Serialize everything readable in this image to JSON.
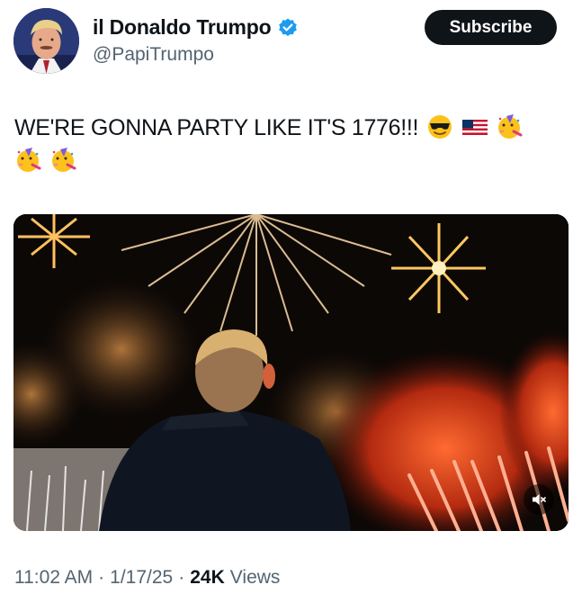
{
  "author": {
    "display_name": "il Donaldo Trumpo",
    "handle": "@PapiTrumpo",
    "verified_color": "#1d9bf0"
  },
  "subscribe_label": "Subscribe",
  "tweet": {
    "text": "WE'RE GONNA PARTY LIKE IT'S 1776!!!",
    "emojis": [
      "sunglasses-face-emoji",
      "us-flag-emoji",
      "partying-face-emoji",
      "partying-face-emoji",
      "partying-face-emoji"
    ]
  },
  "media": {
    "type": "video",
    "muted": true
  },
  "meta": {
    "time": "11:02 AM",
    "date": "1/17/25",
    "separator": "·",
    "views_count": "24K",
    "views_label": "Views"
  }
}
